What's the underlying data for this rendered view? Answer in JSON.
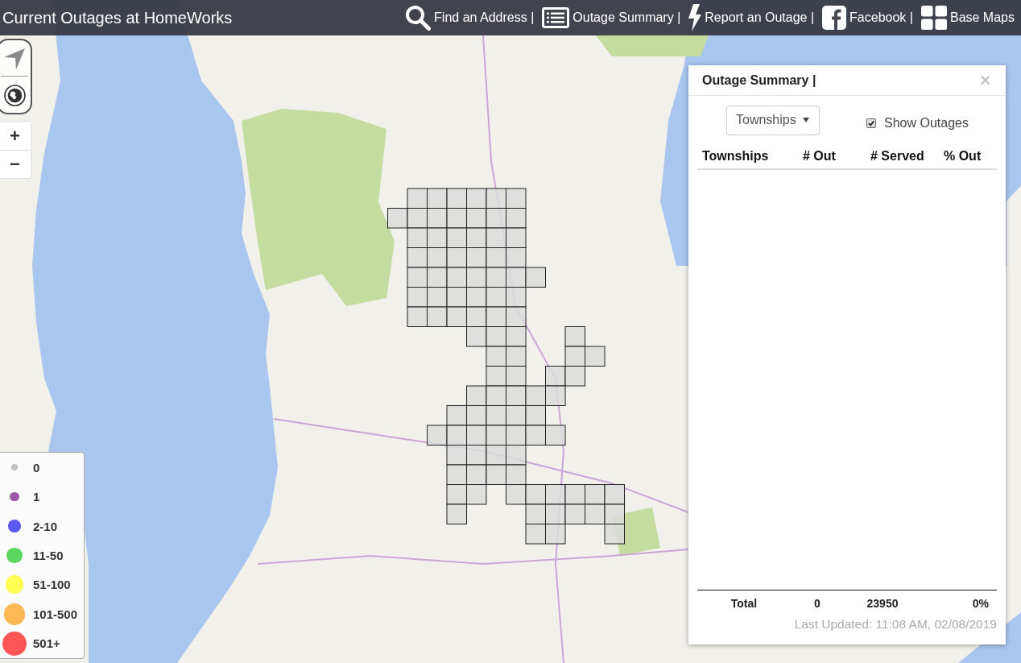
{
  "header": {
    "title": "Current Outages at HomeWorks",
    "menu": [
      {
        "label": "Find an Address |",
        "kind": "search"
      },
      {
        "label": "Outage Summary |",
        "kind": "list"
      },
      {
        "label": "Report an Outage |",
        "kind": "bolt"
      },
      {
        "label": "Facebook |",
        "kind": "facebook"
      },
      {
        "label": "Base Maps",
        "kind": "grid"
      }
    ]
  },
  "map_controls": {
    "zoom": [
      "+",
      "−"
    ]
  },
  "legend": [
    {
      "label": "0",
      "color": "#c2c2c2"
    },
    {
      "label": "1",
      "color": "#9b59a6"
    },
    {
      "label": "2-10",
      "color": "#5b5bf2"
    },
    {
      "label": "11-50",
      "color": "#5cd65c"
    },
    {
      "label": "51-100",
      "color": "#ffff55"
    },
    {
      "label": "101-500",
      "color": "#ffb855"
    },
    {
      "label": "501+",
      "color": "#ff5555"
    }
  ],
  "summary_panel": {
    "title": "Outage Summary |",
    "close": "×",
    "dropdown": {
      "value": "Townships"
    },
    "show_outages": {
      "label": "Show Outages",
      "checked": true
    },
    "columns": [
      "Townships",
      "# Out",
      "# Served",
      "% Out"
    ],
    "total": [
      "Total",
      "0",
      "23950",
      "0%"
    ],
    "last_updated": "Last Updated: 11:08 AM, 02/08/2019"
  }
}
